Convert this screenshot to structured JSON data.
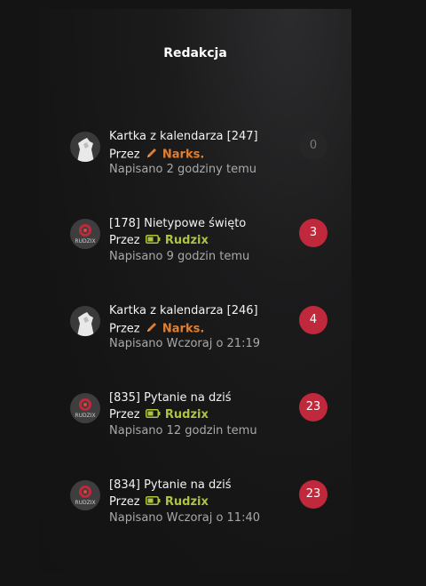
{
  "panel": {
    "title": "Redakcja"
  },
  "colors": {
    "accent_red": "#c0283b",
    "author_orange": "#e07f31",
    "author_green": "#adc43c"
  },
  "posts": [
    {
      "title": "Kartka z kalendarza [247]",
      "by_prefix": "Przez",
      "author": "Narks.",
      "author_icon": "pencil-icon",
      "posted": "Napisano 2 godziny temu",
      "comments": "0"
    },
    {
      "title": "[178] Nietypowe święto",
      "by_prefix": "Przez",
      "author": "Rudzix",
      "author_icon": "battery-icon",
      "posted": "Napisano 9 godzin temu",
      "comments": "3"
    },
    {
      "title": "Kartka z kalendarza [246]",
      "by_prefix": "Przez",
      "author": "Narks.",
      "author_icon": "pencil-icon",
      "posted": "Napisano Wczoraj o 21:19",
      "comments": "4"
    },
    {
      "title": "[835] Pytanie na dziś",
      "by_prefix": "Przez",
      "author": "Rudzix",
      "author_icon": "battery-icon",
      "posted": "Napisano 12 godzin temu",
      "comments": "23"
    },
    {
      "title": "[834] Pytanie na dziś",
      "by_prefix": "Przez",
      "author": "Rudzix",
      "author_icon": "battery-icon",
      "posted": "Napisano Wczoraj o 11:40",
      "comments": "23"
    }
  ],
  "avatar_labels": {
    "rudzix": "RUDZIX"
  }
}
